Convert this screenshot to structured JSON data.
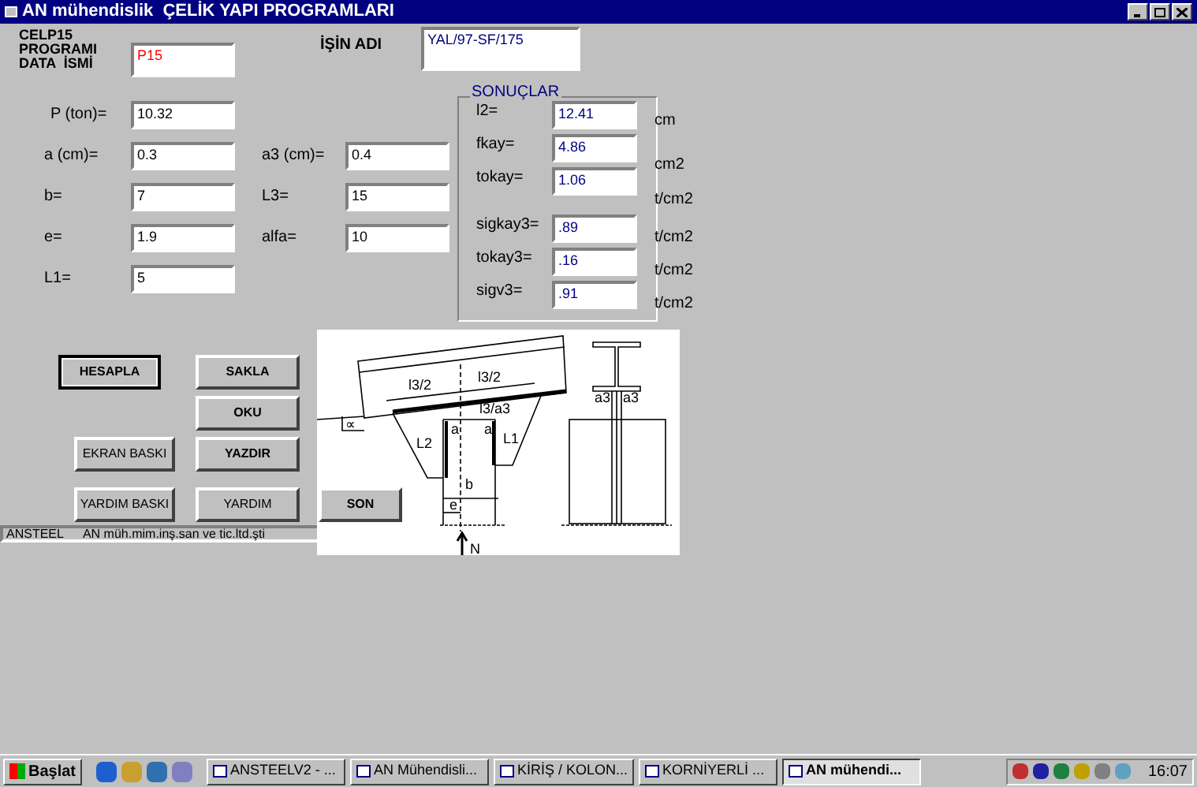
{
  "window": {
    "title": "AN mühendislik  ÇELİK YAPI PROGRAMLARI"
  },
  "header": {
    "program_label": [
      "CELP15",
      "PROGRAMI",
      "DATA  İSMİ"
    ],
    "data_name": "P15",
    "job_label": "İŞİN ADI",
    "job_name": "YAL/97-SF/175"
  },
  "inputs": [
    {
      "label": "P (ton)=",
      "value": "10.32"
    },
    {
      "label": "a (cm)=",
      "value": "0.3"
    },
    {
      "label": "b=",
      "value": "7"
    },
    {
      "label": "e=",
      "value": "1.9"
    },
    {
      "label": "L1=",
      "value": "5"
    },
    {
      "label": "a3 (cm)=",
      "value": "0.4"
    },
    {
      "label": "L3=",
      "value": "15"
    },
    {
      "label": "alfa=",
      "value": "10"
    }
  ],
  "results": {
    "title": "SONUÇLAR",
    "rows": [
      {
        "label": "l2=",
        "value": "12.41",
        "unit": "cm"
      },
      {
        "label": "fkay=",
        "value": "4.86",
        "unit": "cm2"
      },
      {
        "label": "tokay=",
        "value": "1.06",
        "unit": "t/cm2"
      },
      {
        "label": "sigkay3=",
        "value": ".89",
        "unit": "t/cm2"
      },
      {
        "label": "tokay3=",
        "value": ".16",
        "unit": "t/cm2"
      },
      {
        "label": "sigv3=",
        "value": ".91",
        "unit": "t/cm2"
      }
    ]
  },
  "buttons": [
    {
      "label": "HESAPLA",
      "default": true,
      "bold": true
    },
    {
      "label": "SAKLA",
      "default": false,
      "bold": true
    },
    {
      "label": "OKU",
      "default": false,
      "bold": true
    },
    {
      "label": "EKRAN BASKI",
      "default": false,
      "bold": false
    },
    {
      "label": "YAZDIR",
      "default": false,
      "bold": true
    },
    {
      "label": "YARDIM BASKI",
      "default": false,
      "bold": false
    },
    {
      "label": "YARDIM",
      "default": false,
      "bold": false
    },
    {
      "label": "SON",
      "default": false,
      "bold": true
    }
  ],
  "status_bar": {
    "left": "ANSTEEL",
    "right": "AN müh.mim.inş.san ve tic.ltd.şti"
  },
  "drawing": {
    "labels": [
      "l3/2",
      "l3/2",
      "l3/a3",
      "∝",
      "L2",
      "a",
      "a",
      "L1",
      "b",
      "e",
      "N",
      "a3",
      "a3"
    ]
  },
  "taskbar": {
    "start": "Başlat",
    "tasks": [
      {
        "label": "ANSTEELV2 - ...",
        "selected": false
      },
      {
        "label": "AN Mühendisli...",
        "selected": false
      },
      {
        "label": "KİRİŞ / KOLON...",
        "selected": false
      },
      {
        "label": "KORNİYERLİ ...",
        "selected": false
      },
      {
        "label": "AN mühendi...",
        "selected": true
      }
    ],
    "clock": "16:07"
  }
}
